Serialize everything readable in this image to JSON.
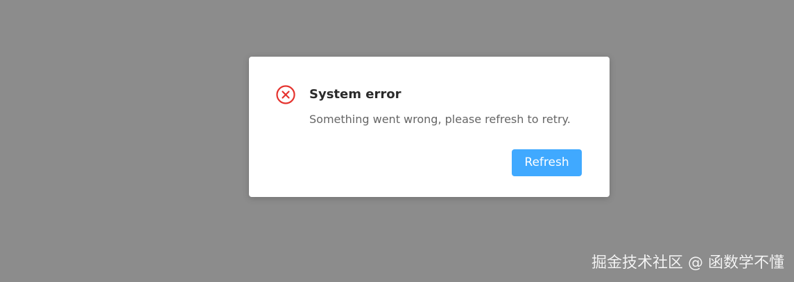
{
  "colors": {
    "overlay": "#8c8c8c",
    "error": "#e5322d",
    "primary": "#40a9ff"
  },
  "dialog": {
    "icon": "error-circle-icon",
    "title": "System error",
    "message": "Something went wrong, please refresh to retry.",
    "refresh_label": "Refresh"
  },
  "watermark": {
    "text": "掘金技术社区 @ 函数学不懂"
  }
}
